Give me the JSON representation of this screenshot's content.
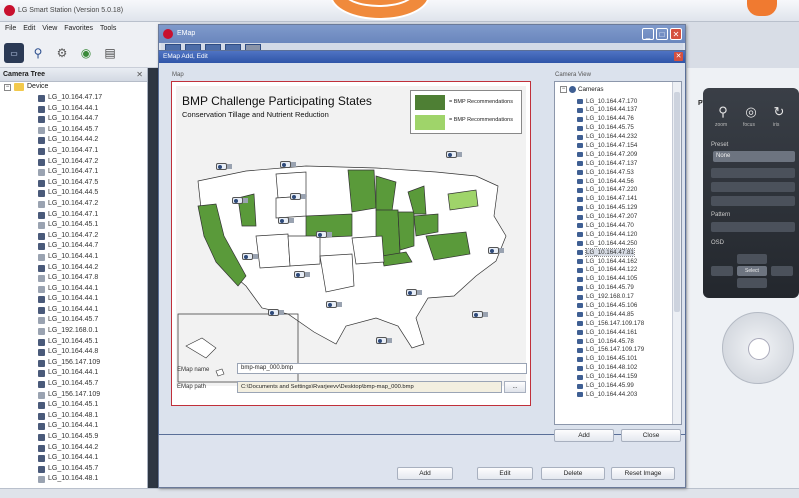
{
  "app": {
    "title": "LG Smart Station (Version 5.0.18)",
    "menu": [
      "File",
      "Edit",
      "View",
      "Favorites",
      "Tools"
    ],
    "camera_tree": {
      "header": "Camera Tree",
      "root": "Device",
      "items": [
        "LG_10.164.47.17",
        "LG_10.164.44.1",
        "LG_10.164.44.7",
        "LG_10.164.45.7",
        "LG_10.164.44.2",
        "LG_10.164.47.1",
        "LG_10.164.47.2",
        "LG_10.164.47.1",
        "LG_10.164.47.5",
        "LG_10.164.44.5",
        "LG_10.164.47.2",
        "LG_10.164.47.1",
        "LG_10.164.45.1",
        "LG_10.164.47.2",
        "LG_10.164.44.7",
        "LG_10.164.44.1",
        "LG_10.164.44.2",
        "LG_10.164.47.8",
        "LG_10.164.44.1",
        "LG_10.164.44.1",
        "LG_10.164.44.1",
        "LG_10.164.45.7",
        "LG_192.168.0.1",
        "LG_10.164.45.1",
        "LG_10.164.44.8",
        "LG_156.147.109",
        "LG_10.164.44.1",
        "LG_10.164.45.7",
        "LG_156.147.109",
        "LG_10.164.45.1",
        "LG_10.164.48.1",
        "LG_10.164.44.1",
        "LG_10.164.45.9",
        "LG_10.164.44.2",
        "LG_10.164.44.1",
        "LG_10.164.45.7",
        "LG_10.164.48.1"
      ]
    },
    "ptz": {
      "label": "PTZ",
      "icons": [
        "zoom-icon",
        "focus-icon",
        "iris-icon"
      ],
      "sub_labels": [
        "zoom",
        "focus",
        "iris"
      ],
      "preset_label": "Preset",
      "preset_value": "None",
      "pattern_label": "Pattern",
      "osd_label": "OSD",
      "select_label": "Select"
    },
    "colors": {
      "map_green": "#5a9a3a",
      "map_light_green": "#9fd46a",
      "title_blue": "#3556a6",
      "app_red": "#c8102e"
    }
  },
  "emap": {
    "title": "EMap",
    "buttons": [
      "Add",
      "Edit",
      "Delete",
      "Reset Image"
    ]
  },
  "dialog": {
    "title": "EMap Add, Edit",
    "map_group_label": "Map",
    "map_image": {
      "title": "BMP Challenge Participating States",
      "subtitle": "Conservation Tillage and Nutrient Reduction",
      "legend": [
        {
          "label": "= BMP Recommendations",
          "color": "#4e7f34"
        },
        {
          "label": "= BMP Recommendations",
          "color": "#9fd46a"
        }
      ]
    },
    "emap_name_label": "EMap name",
    "emap_name_value": "bmp-map_000.bmp",
    "emap_path_label": "EMap path",
    "emap_path_value": "C:\\Documents and Settings\\Rvarjeevv\\Desktop\\bmp-map_000.bmp",
    "browse_label": "...",
    "camera_view_label": "Camera View",
    "camera_view_root": "Cameras",
    "camera_view_items": [
      "LG_10.164.47.170",
      "LG_10.164.44.137",
      "LG_10.164.44.76",
      "LG_10.164.45.75",
      "LG_10.164.44.232",
      "LG_10.164.47.154",
      "LG_10.164.47.209",
      "LG_10.164.47.137",
      "LG_10.164.47.53",
      "LG_10.164.44.56",
      "LG_10.164.47.220",
      "LG_10.164.47.141",
      "LG_10.164.45.129",
      "LG_10.164.47.207",
      "LG_10.164.44.70",
      "LG_10.164.44.120",
      "LG_10.164.44.250",
      "LG_10.164.47.81",
      "LG_10.164.44.162",
      "LG_10.164.44.122",
      "LG_10.164.44.105",
      "LG_10.164.45.79",
      "LG_192.168.0.17",
      "LG_10.164.45.106",
      "LG_10.164.44.85",
      "LG_156.147.109.178",
      "LG_10.164.44.161",
      "LG_10.164.45.78",
      "LG_156.147.109.179",
      "LG_10.164.45.101",
      "LG_10.164.48.102",
      "LG_10.164.44.159",
      "LG_10.164.45.99",
      "LG_10.164.44.203"
    ],
    "selected_index": 17,
    "add_label": "Add",
    "close_label": "Close"
  }
}
